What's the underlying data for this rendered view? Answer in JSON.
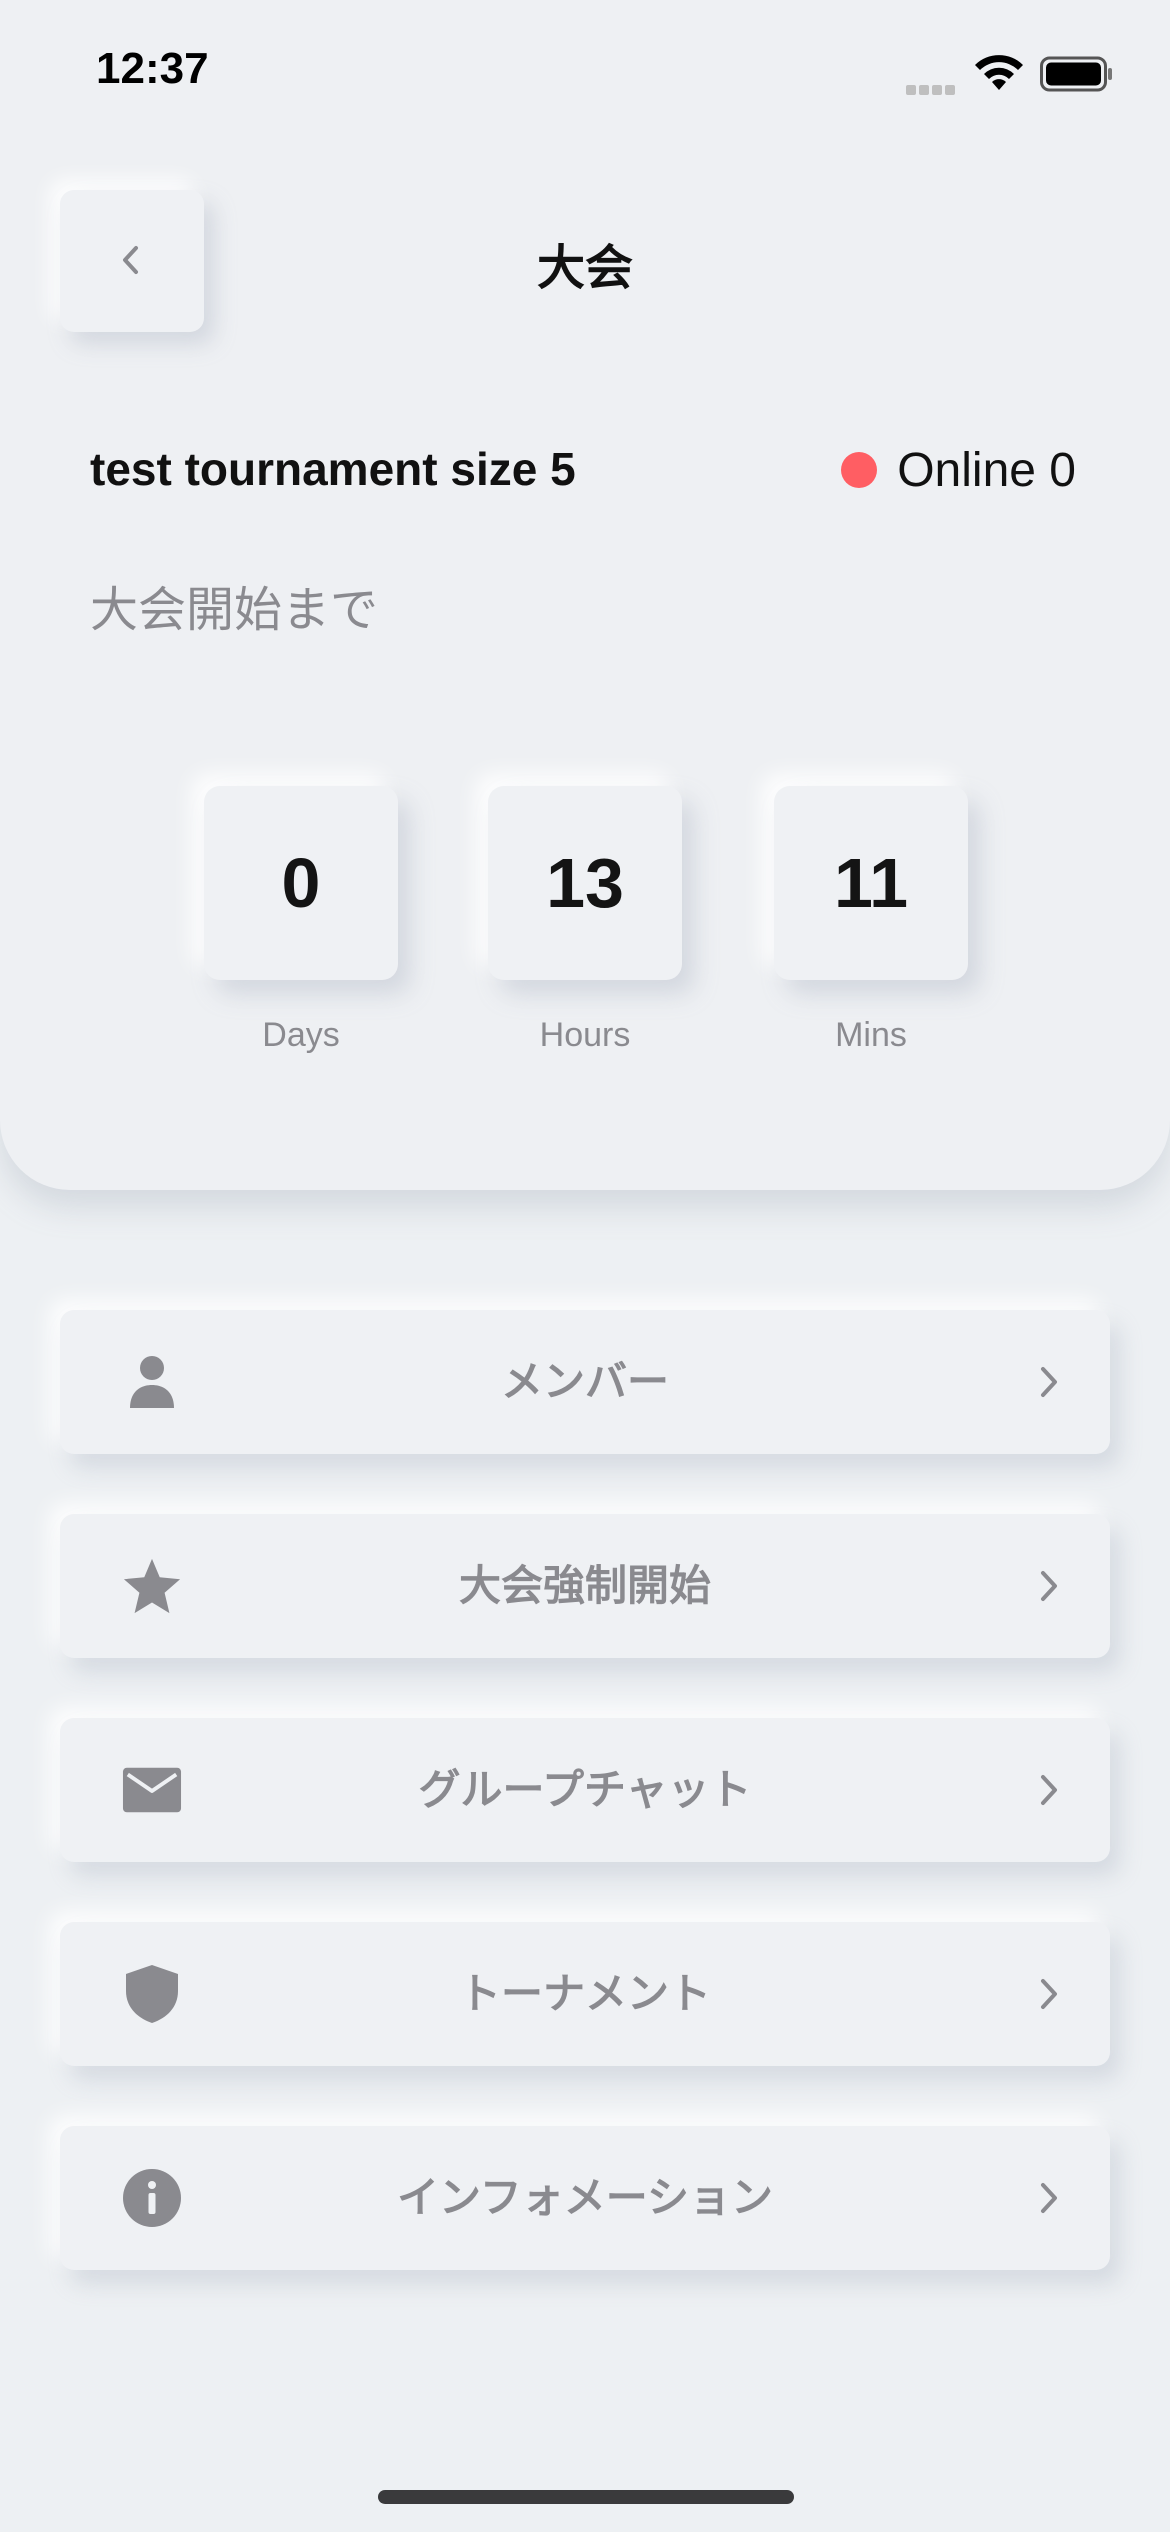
{
  "status_bar": {
    "time": "12:37"
  },
  "header": {
    "title": "大会",
    "back_icon": "chevron-left-icon"
  },
  "tournament": {
    "name": "test tournament size 5",
    "online_label": "Online 0",
    "online_color": "#ff5e63",
    "until_start_label": "大会開始まで"
  },
  "countdown": [
    {
      "value": "0",
      "label": "Days"
    },
    {
      "value": "13",
      "label": "Hours"
    },
    {
      "value": "11",
      "label": "Mins"
    }
  ],
  "menu": [
    {
      "label": "メンバー",
      "icon": "person-icon"
    },
    {
      "label": "大会強制開始",
      "icon": "star-icon"
    },
    {
      "label": "グループチャット",
      "icon": "mail-icon"
    },
    {
      "label": "トーナメント",
      "icon": "shield-icon"
    },
    {
      "label": "インフォメーション",
      "icon": "info-icon"
    }
  ],
  "colors": {
    "background": "#edf0f3",
    "muted_text": "#8a8a8f",
    "icon_gray": "#8a8a8f"
  }
}
